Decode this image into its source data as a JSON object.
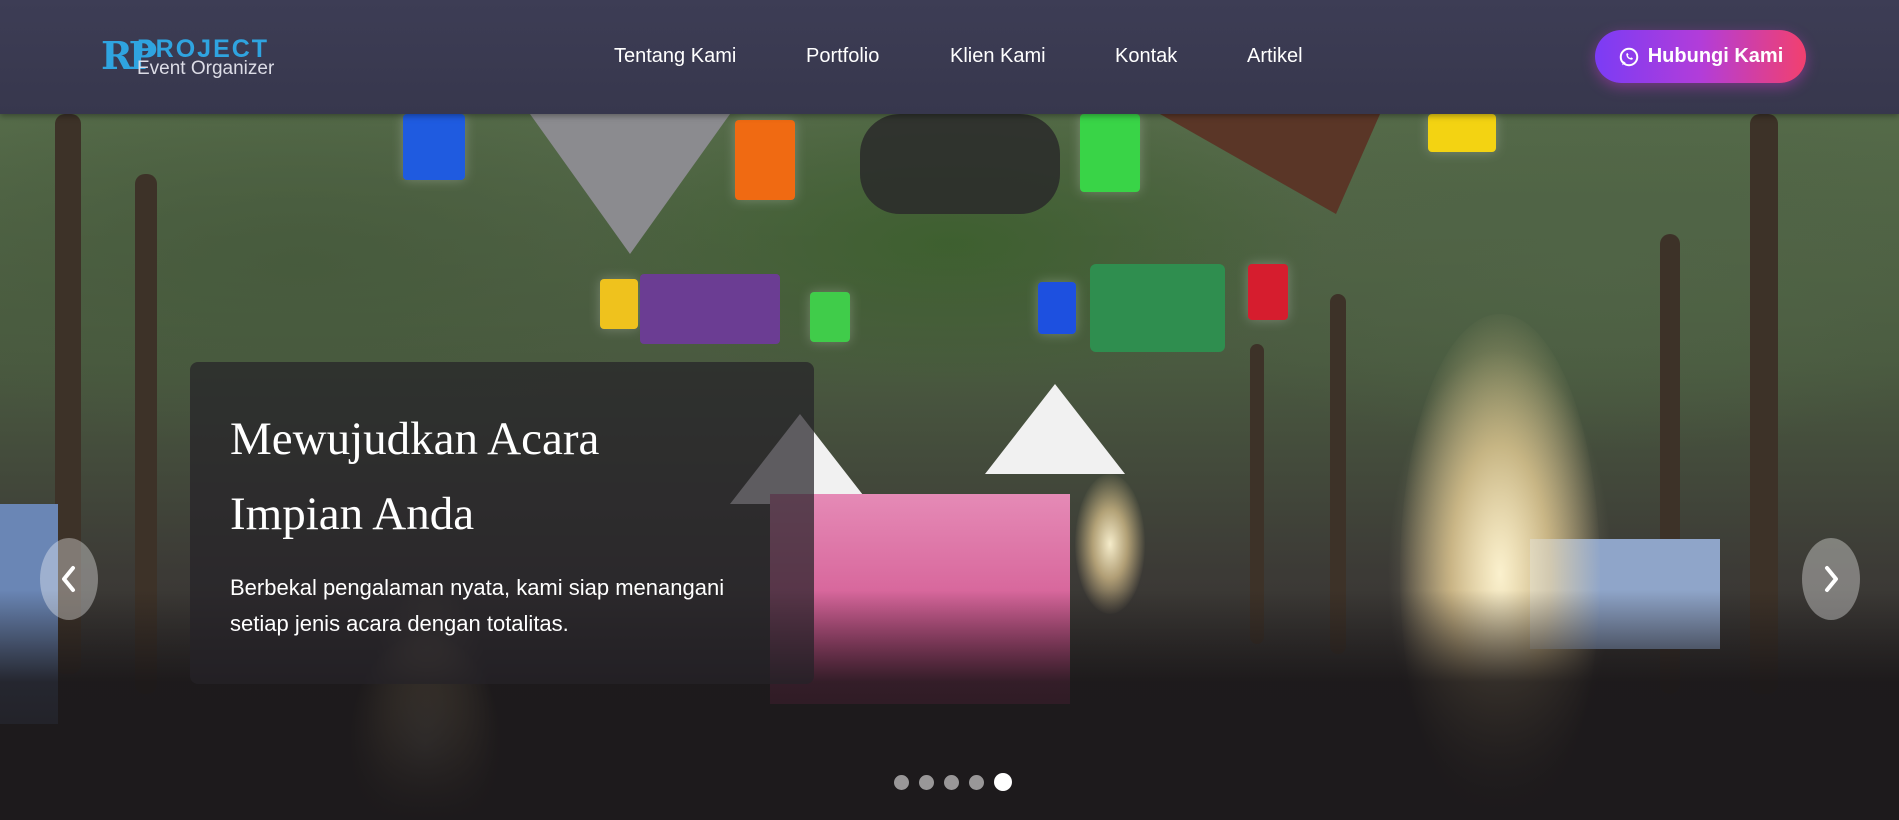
{
  "brand": {
    "mark": "RP",
    "name": "PROJECT",
    "tagline": "Event Organizer"
  },
  "nav": {
    "items": [
      {
        "label": "Tentang Kami"
      },
      {
        "label": "Portfolio"
      },
      {
        "label": "Klien Kami"
      },
      {
        "label": "Kontak"
      },
      {
        "label": "Artikel"
      }
    ]
  },
  "cta": {
    "label": "Hubungi Kami",
    "icon": "whatsapp-icon"
  },
  "hero": {
    "title_line1": "Mewujudkan Acara",
    "title_line2": "Impian Anda",
    "subtitle_line1": "Berbekal pengalaman nyata, kami siap menangani",
    "subtitle_line2": "setiap jenis acara dengan totalitas.",
    "prev_icon": "chevron-left-icon",
    "next_icon": "chevron-right-icon",
    "slide_count": 5,
    "active_slide": 5
  },
  "colors": {
    "navbar": "#3b3b52",
    "brand_blue": "#2fa4e0",
    "cta_start": "#7b3cf5",
    "cta_end": "#f2406e"
  }
}
